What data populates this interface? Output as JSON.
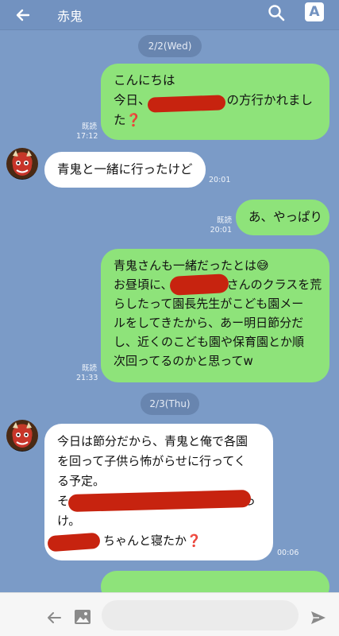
{
  "header": {
    "title": "赤鬼",
    "back_icon": "back-arrow-icon",
    "search_icon": "search-icon",
    "font_button_label": "A"
  },
  "dates": {
    "d1": "2/2(Wed)",
    "d2": "2/3(Thu)"
  },
  "messages": {
    "m1": {
      "lines": [
        "こんにちは",
        "今日、",
        "の方行かれまし",
        "た"
      ],
      "read": "既読",
      "time": "17:12",
      "qmark": "❓"
    },
    "m2": {
      "text": "青鬼と一緒に行ったけど",
      "time": "20:01"
    },
    "m3": {
      "text": "あ、やっぱり",
      "read": "既読",
      "time": "20:01"
    },
    "m4": {
      "lines": [
        "青鬼さんも一緒だったとは😅",
        "お昼頃に、",
        "さんのクラスを荒",
        "らしたって園長先生がこども園メー",
        "ルをしてきたから、あー明日節分だ",
        "し、近くのこども園や保育園とか順",
        "次回ってるのかと思ってw"
      ],
      "read": "既読",
      "time": "21:33"
    },
    "m5": {
      "lines": [
        "今日は節分だから、青鬼と俺で各園",
        "を回って子供ら怖がらせに行ってく",
        "る予定。",
        "そ",
        "っ",
        "け。",
        "ちゃんと寝たか"
      ],
      "time": "00:06",
      "qmark": "❓"
    }
  },
  "footer": {
    "input_placeholder": "",
    "back_icon": "back-arrow-icon",
    "image_icon": "image-icon",
    "send_icon": "send-icon"
  },
  "colors": {
    "background": "#7b9bc7",
    "outgoing_bubble": "#8ee37a",
    "incoming_bubble": "#ffffff",
    "redaction": "#c7230f"
  }
}
